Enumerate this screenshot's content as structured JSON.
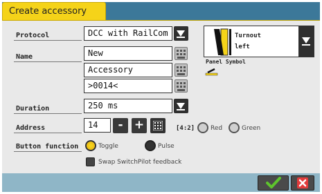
{
  "window": {
    "title": "Create accessory"
  },
  "form": {
    "protocol": {
      "label": "Protocol",
      "value": "DCC with RailCom"
    },
    "name": {
      "label": "Name",
      "line1": "New",
      "line2": "Accessory",
      "line3": ">0014<"
    },
    "duration": {
      "label": "Duration",
      "value": "250 ms"
    },
    "address": {
      "label": "Address",
      "value": "14",
      "minus": "-",
      "plus": "+",
      "port": "[4:2]",
      "red": "Red",
      "green": "Green"
    },
    "button_function": {
      "label": "Button function",
      "toggle": "Toggle",
      "pulse": "Pulse",
      "selected": "Toggle"
    },
    "swap": {
      "label": "Swap SwitchPilot feedback",
      "checked": false
    }
  },
  "turnout": {
    "line1": "Turnout",
    "line2": "left",
    "panel_symbol_label": "Panel Symbol"
  },
  "colors": {
    "accent": "#f5d319",
    "titlebar": "#3c7899",
    "footer": "#8fb6c7",
    "ok": "#5ec52d",
    "cancel": "#e23b3b"
  }
}
